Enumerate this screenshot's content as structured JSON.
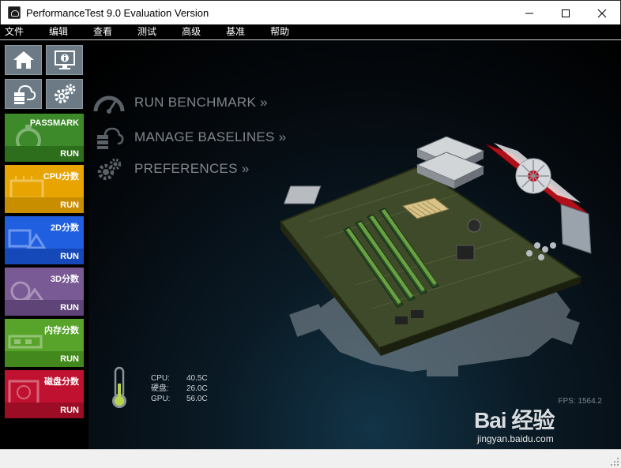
{
  "window": {
    "title": "PerformanceTest 9.0 Evaluation Version"
  },
  "menu": [
    {
      "label": "文件"
    },
    {
      "label": "编辑"
    },
    {
      "label": "查看"
    },
    {
      "label": "测试"
    },
    {
      "label": "高级"
    },
    {
      "label": "基准"
    },
    {
      "label": "帮助"
    }
  ],
  "sidebar": {
    "icon_tiles": [
      {
        "icon": "home-icon"
      },
      {
        "icon": "system-info-icon"
      },
      {
        "icon": "cloud-baseline-icon"
      },
      {
        "icon": "gears-icon"
      }
    ],
    "tests": [
      {
        "label": "PASSMARK",
        "run": "RUN",
        "color": "#3d8a2a",
        "bar": "#2d6e1c"
      },
      {
        "label": "CPU分数",
        "run": "RUN",
        "color": "#e8a400",
        "bar": "#c98d00"
      },
      {
        "label": "2D分数",
        "run": "RUN",
        "color": "#1f5fe0",
        "bar": "#1548b8"
      },
      {
        "label": "3D分数",
        "run": "RUN",
        "color": "#7a5a94",
        "bar": "#5f4478"
      },
      {
        "label": "内存分数",
        "run": "RUN",
        "color": "#58a42a",
        "bar": "#43881c"
      },
      {
        "label": "磁盘分数",
        "run": "RUN",
        "color": "#c01230",
        "bar": "#9a0d24"
      }
    ]
  },
  "nav": {
    "run_benchmark": "RUN BENCHMARK »",
    "manage_baselines": "MANAGE BASELINES »",
    "preferences": "PREFERENCES »"
  },
  "temps": {
    "cpu_label": "CPU:",
    "cpu_value": "40.5C",
    "disk_label": "硬盘:",
    "disk_value": "26.0C",
    "gpu_label": "GPU:",
    "gpu_value": "56.0C"
  },
  "fps": "FPS: 1564.2",
  "watermark": {
    "main": "Bai  经验",
    "sub": "jingyan.baidu.com"
  },
  "colors": {
    "accent_text": "#7f868c",
    "menubar": "#000000"
  }
}
